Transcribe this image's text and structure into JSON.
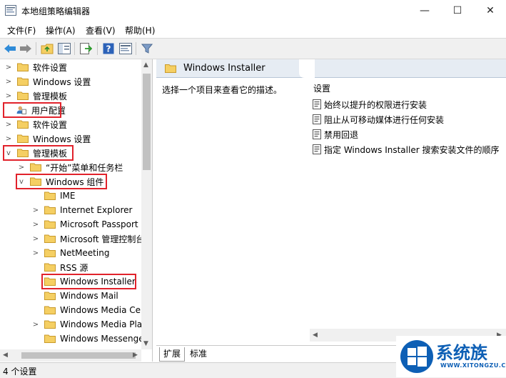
{
  "window": {
    "title": "本地组策略编辑器",
    "minimize": "—",
    "maximize": "☐",
    "close": "✕"
  },
  "menu": [
    "文件(F)",
    "操作(A)",
    "查看(V)",
    "帮助(H)"
  ],
  "toolbar": {
    "icons": [
      "back-arrow-icon",
      "forward-arrow-icon",
      "up-folder-icon",
      "show-hide-tree-icon",
      "export-list-icon",
      "help-icon",
      "properties-icon",
      "filter-icon"
    ]
  },
  "tree": [
    {
      "label": "软件设置",
      "expander": ">"
    },
    {
      "label": "Windows 设置",
      "expander": ">"
    },
    {
      "label": "管理模板",
      "expander": ">"
    },
    {
      "label": "用户配置",
      "expander": ""
    },
    {
      "label": "软件设置",
      "expander": ">"
    },
    {
      "label": "Windows 设置",
      "expander": ">"
    },
    {
      "label": "管理模板",
      "expander": "v"
    },
    {
      "label": "“开始”菜单和任务栏",
      "expander": ">"
    },
    {
      "label": "Windows 组件",
      "expander": "v"
    },
    {
      "label": "IME",
      "expander": ""
    },
    {
      "label": "Internet Explorer",
      "expander": ">"
    },
    {
      "label": "Microsoft Passport",
      "expander": ">"
    },
    {
      "label": "Microsoft 管理控制台",
      "expander": ">"
    },
    {
      "label": "NetMeeting",
      "expander": ">"
    },
    {
      "label": "RSS 源",
      "expander": ""
    },
    {
      "label": "Windows Installer",
      "expander": ""
    },
    {
      "label": "Windows Mail",
      "expander": ""
    },
    {
      "label": "Windows Media Center",
      "expander": ""
    },
    {
      "label": "Windows Media Player",
      "expander": ">"
    },
    {
      "label": "Windows Messenger",
      "expander": ""
    }
  ],
  "right": {
    "header_title": "Windows Installer",
    "description": "选择一个项目来查看它的描述。",
    "settings_header": "设置",
    "settings": [
      "始终以提升的权限进行安装",
      "阻止从可移动媒体进行任何安装",
      "禁用回退",
      "指定 Windows Installer 搜索安装文件的顺序"
    ]
  },
  "tabs": [
    "扩展",
    "标准"
  ],
  "status": "4 个设置",
  "watermark": {
    "text": "系统族",
    "url": "WWW.XITONGZU.COM"
  },
  "colors": {
    "highlight": "#e1222b",
    "folder": "#f5cf63",
    "header_bg": "#e6ecf3",
    "brand": "#0d5fb5"
  }
}
